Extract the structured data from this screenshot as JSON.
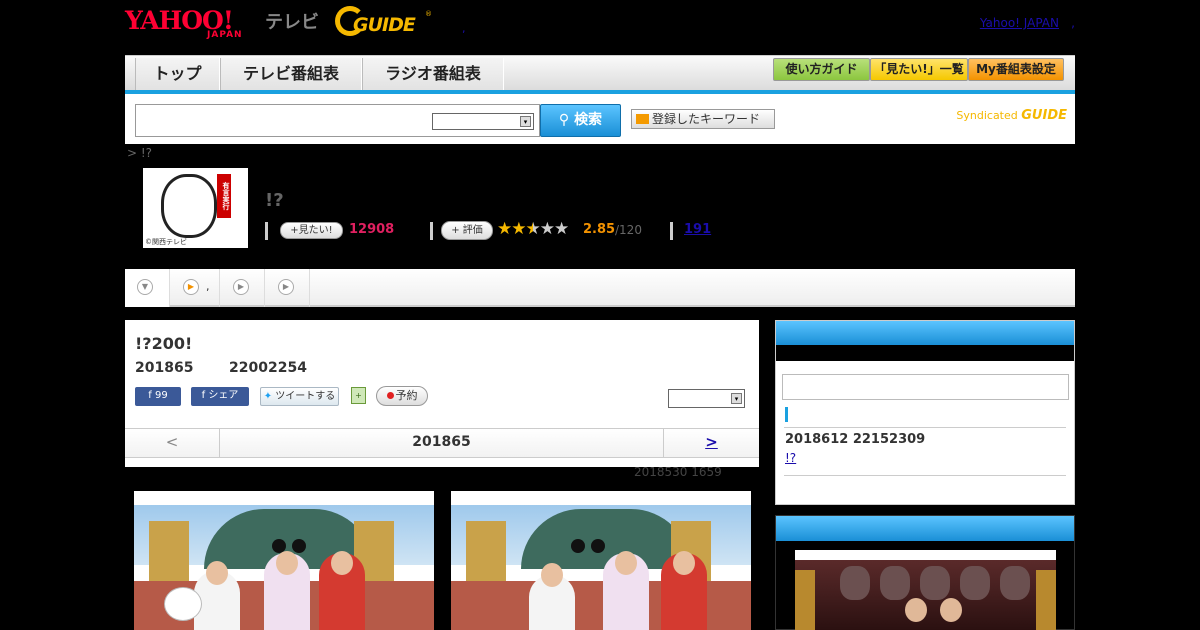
{
  "header": {
    "yahoo_logo": "YAHOO!",
    "yahoo_sub": "JAPAN",
    "tv_label": "テレビ",
    "gguide_logo": "GUIDE",
    "gguide_reg": "®",
    "dot": ",",
    "yahoo_japan_link": "Yahoo! JAPAN",
    "comma": ","
  },
  "nav": {
    "tabs": [
      "トップ",
      "テレビ番組表",
      "ラジオ番組表"
    ],
    "buttons": [
      {
        "label": "使い方ガイド",
        "color": "#8cc63f"
      },
      {
        "label": "「見たい!」一覧",
        "color": "#f5c800"
      },
      {
        "label": "My番組表設定",
        "color": "#f39200"
      }
    ],
    "accent_color": "#1aa1e0"
  },
  "search": {
    "input_value": "",
    "select_value": "",
    "select_arrow": "▾",
    "button_label": "検索",
    "button_icon": "search-icon",
    "keyword_button": "登録したキーワード",
    "syndicated_label": "Syndicated",
    "syndicated_logo": "GUIDE"
  },
  "program": {
    "breadcrumb": "> !?",
    "logo_caption": "©関西テレビ",
    "logo_text": "有言実行",
    "title": "!?",
    "mitai_button": "見たい!",
    "mitai_count": "12908",
    "hyoka_button": "評価",
    "rating_stars": 2.5,
    "rating_value": "2.85",
    "rating_total": "/120",
    "review_count": "191"
  },
  "tabs": [
    {
      "icon": "chevron-down-icon",
      "label": "",
      "active": true
    },
    {
      "icon": "play-icon",
      "label": ",",
      "active": false
    },
    {
      "icon": "play-icon",
      "label": "",
      "active": false
    },
    {
      "icon": "play-icon",
      "label": "",
      "active": false
    }
  ],
  "article": {
    "title": "!?200!",
    "date": "201865",
    "time": "22002254",
    "fb_like": "99",
    "fb_share": "シェア",
    "tweet": "ツイートする",
    "yoyaku": "予約",
    "select_value": "",
    "select_arrow": "▾",
    "pager_prev": "<",
    "pager_date": "201865",
    "pager_next": ">",
    "updated": "2018530  1659"
  },
  "sidebar": {
    "search_value": "",
    "date": "2018612  22152309",
    "link": "!?"
  }
}
